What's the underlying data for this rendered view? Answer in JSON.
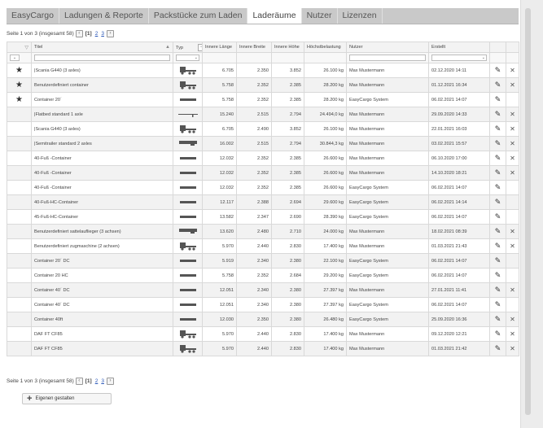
{
  "tabs": [
    {
      "label": "EasyCargo",
      "active": false
    },
    {
      "label": "Ladungen & Reporte",
      "active": false
    },
    {
      "label": "Packstücke zum Laden",
      "active": false
    },
    {
      "label": "Laderäume",
      "active": true
    },
    {
      "label": "Nutzer",
      "active": false
    },
    {
      "label": "Lizenzen",
      "active": false
    }
  ],
  "pager": {
    "summary": "Seite 1 von 3 (insgesamt 58)",
    "current": "[1]",
    "page2": "2",
    "page3": "3"
  },
  "columns": {
    "title": "Titel",
    "type": "Typ",
    "inner_length": "Innere Länge",
    "inner_width": "Innere Breite",
    "inner_height": "Innere Höhe",
    "max_load": "Höchstbelastung",
    "user": "Nutzer",
    "created": "Erstellt"
  },
  "rows": [
    {
      "fav": true,
      "title": "|Scania G440 (3 axles)",
      "type": "truck-icon",
      "length": "6.705",
      "width": "2.350",
      "height": "3.852",
      "load": "26.100 kg",
      "user": "Max Mustermann",
      "created": "02.12.2020 14:11",
      "deletable": true
    },
    {
      "fav": true,
      "title": "Benutzerdefiniert container",
      "type": "truck-icon",
      "length": "5.758",
      "width": "2.352",
      "height": "2.385",
      "load": "28.200 kg",
      "user": "Max Mustermann",
      "created": "01.12.2021 16:34",
      "deletable": true
    },
    {
      "fav": true,
      "title": "Container 20´",
      "type": "container-icon",
      "length": "5.758",
      "width": "2.352",
      "height": "2.385",
      "load": "28.200 kg",
      "user": "EasyCargo System",
      "created": "06.02.2021 14:07",
      "deletable": false
    },
    {
      "fav": false,
      "title": "|Flatbed standard 1 axle",
      "type": "flatbed-icon",
      "length": "15.240",
      "width": "2.515",
      "height": "2.794",
      "load": "24.494,0 kg",
      "user": "Max Mustermann",
      "created": "29.09.2020 14:33",
      "deletable": true
    },
    {
      "fav": false,
      "title": "|Scania G440 (3 axles)",
      "type": "truck-icon",
      "length": "6.705",
      "width": "2.490",
      "height": "3.852",
      "load": "26.100 kg",
      "user": "Max Mustermann",
      "created": "22.01.2021 16:03",
      "deletable": true
    },
    {
      "fav": false,
      "title": "|Semitrailer standard 2 axles",
      "type": "semitrailer-icon",
      "length": "16.002",
      "width": "2.515",
      "height": "2.794",
      "load": "30.844,3 kg",
      "user": "Max Mustermann",
      "created": "03.02.2021 15:57",
      "deletable": true
    },
    {
      "fav": false,
      "title": "40-Fuß -Container",
      "type": "container-icon",
      "length": "12.032",
      "width": "2.352",
      "height": "2.385",
      "load": "26.600 kg",
      "user": "Max Mustermann",
      "created": "06.10.2020 17:00",
      "deletable": true
    },
    {
      "fav": false,
      "title": "40-Fuß -Container",
      "type": "container-icon",
      "length": "12.032",
      "width": "2.352",
      "height": "2.385",
      "load": "26.600 kg",
      "user": "Max Mustermann",
      "created": "14.10.2020 18:21",
      "deletable": true
    },
    {
      "fav": false,
      "title": "40-Fuß -Container",
      "type": "container-icon",
      "length": "12.032",
      "width": "2.352",
      "height": "2.385",
      "load": "26.600 kg",
      "user": "EasyCargo System",
      "created": "06.02.2021 14:07",
      "deletable": false
    },
    {
      "fav": false,
      "title": "40-Fuß-HC-Container",
      "type": "container-icon",
      "length": "12.117",
      "width": "2.388",
      "height": "2.694",
      "load": "29.600 kg",
      "user": "EasyCargo System",
      "created": "06.02.2021 14:14",
      "deletable": false
    },
    {
      "fav": false,
      "title": "45-Fuß-HC-Container",
      "type": "container-icon",
      "length": "13.582",
      "width": "2.347",
      "height": "2.690",
      "load": "28.390 kg",
      "user": "EasyCargo System",
      "created": "06.02.2021 14:07",
      "deletable": false
    },
    {
      "fav": false,
      "title": "Benutzerdefiniert sattelauflieger (3 achsen)",
      "type": "semitrailer-icon",
      "length": "13.620",
      "width": "2.480",
      "height": "2.710",
      "load": "24.000 kg",
      "user": "Max Mustermann",
      "created": "18.02.2021 08:39",
      "deletable": true
    },
    {
      "fav": false,
      "title": "Benutzerdefiniert zugmaschine (2 achsen)",
      "type": "truck-icon",
      "length": "5.970",
      "width": "2.440",
      "height": "2.830",
      "load": "17.400 kg",
      "user": "Max Mustermann",
      "created": "01.03.2021 21:43",
      "deletable": true
    },
    {
      "fav": false,
      "title": "Container 20´ DC",
      "type": "container-icon",
      "length": "5.919",
      "width": "2.340",
      "height": "2.380",
      "load": "22.100 kg",
      "user": "EasyCargo System",
      "created": "06.02.2021 14:07",
      "deletable": false
    },
    {
      "fav": false,
      "title": "Container 20 HC",
      "type": "container-icon",
      "length": "5.758",
      "width": "2.352",
      "height": "2.684",
      "load": "29.200 kg",
      "user": "EasyCargo System",
      "created": "06.02.2021 14:07",
      "deletable": false
    },
    {
      "fav": false,
      "title": "Container 40´ DC",
      "type": "container-icon",
      "length": "12.051",
      "width": "2.340",
      "height": "2.380",
      "load": "27.397 kg",
      "user": "Max Mustermann",
      "created": "27.01.2021 11:41",
      "deletable": true
    },
    {
      "fav": false,
      "title": "Container 40´ DC",
      "type": "container-icon",
      "length": "12.051",
      "width": "2.340",
      "height": "2.380",
      "load": "27.397 kg",
      "user": "EasyCargo System",
      "created": "06.02.2021 14:07",
      "deletable": false
    },
    {
      "fav": false,
      "title": "Container 40ft",
      "type": "container-icon",
      "length": "12.030",
      "width": "2.350",
      "height": "2.380",
      "load": "26.480 kg",
      "user": "EasyCargo System",
      "created": "25.09.2020 16:36",
      "deletable": true
    },
    {
      "fav": false,
      "title": "DAF FT CF85",
      "type": "truck-icon",
      "length": "5.970",
      "width": "2.440",
      "height": "2.830",
      "load": "17.400 kg",
      "user": "Max Mustermann",
      "created": "09.12.2020 12:21",
      "deletable": true
    },
    {
      "fav": false,
      "title": "DAF FT CF85",
      "type": "truck-icon",
      "length": "5.970",
      "width": "2.440",
      "height": "2.830",
      "load": "17.400 kg",
      "user": "Max Mustermann",
      "created": "01.03.2021 21:42",
      "deletable": true
    }
  ],
  "add_button": {
    "label": "Eigenen gestalten"
  },
  "icons": {
    "favorite": "star-icon",
    "edit": "pencil-icon",
    "delete": "close-icon",
    "add": "plus-icon"
  }
}
